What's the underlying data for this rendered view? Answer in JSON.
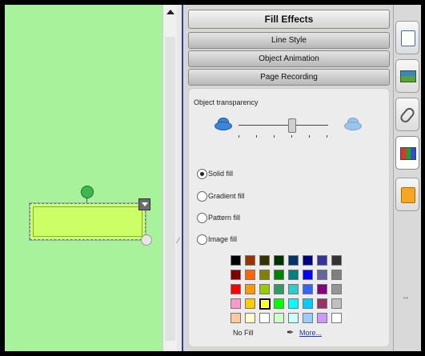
{
  "panel": {
    "headers": {
      "fill_effects": "Fill Effects",
      "line_style": "Line Style",
      "object_animation": "Object Animation",
      "page_recording": "Page Recording"
    },
    "transparency_label": "Object transparency",
    "transparency_level_fraction": 0.6,
    "fill_options": [
      "Solid fill",
      "Gradient fill",
      "Pattern fill",
      "Image fill"
    ],
    "selected_fill_option": "Solid fill",
    "no_fill_label": "No Fill",
    "more_label": "More..."
  },
  "palette": {
    "rows": [
      [
        "#000000",
        "#993300",
        "#333300",
        "#003300",
        "#003366",
        "#000080",
        "#333399",
        "#333333"
      ],
      [
        "#800000",
        "#ff6600",
        "#808000",
        "#008000",
        "#008080",
        "#0000ff",
        "#666699",
        "#808080"
      ],
      [
        "#ff0000",
        "#ff9900",
        "#99cc00",
        "#339966",
        "#33cccc",
        "#3366ff",
        "#800080",
        "#969696"
      ],
      [
        "#ff99cc",
        "#ffcc00",
        "#ffff00",
        "#00ff00",
        "#00ffff",
        "#00ccff",
        "#993366",
        "#c0c0c0"
      ],
      [
        "#ffcc99",
        "#ffffcc",
        "#ffffff",
        "#ccffcc",
        "#ccffff",
        "#99ccff",
        "#cc99ff",
        "#ffffff"
      ]
    ],
    "selected": [
      3,
      2
    ]
  },
  "canvas": {
    "background": "#a8f29b",
    "shape_fill": "#ccff66"
  },
  "tabs": [
    "page-sorter",
    "gallery",
    "attachments",
    "properties",
    "add-ons"
  ],
  "active_tab": "properties"
}
